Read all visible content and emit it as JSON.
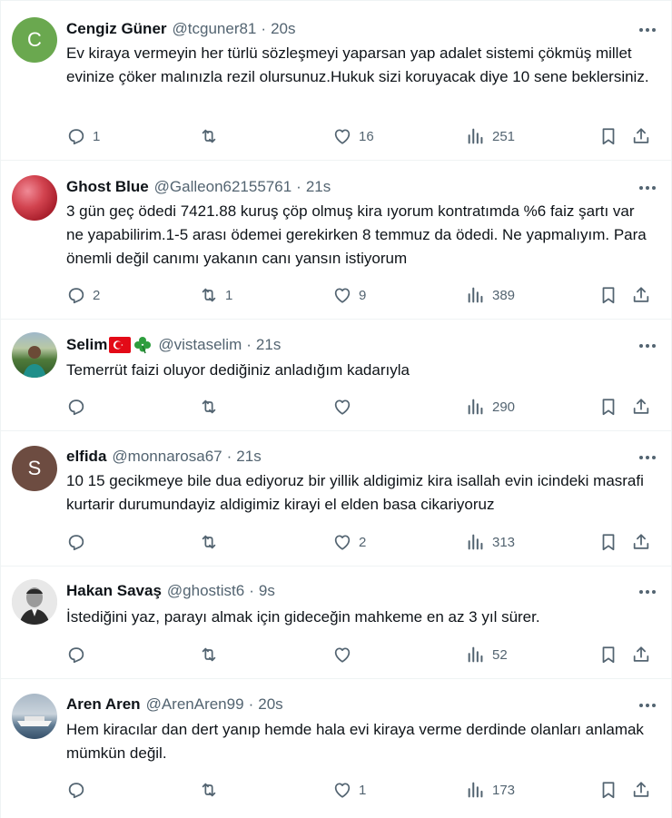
{
  "tweets": [
    {
      "name": "Cengiz Güner",
      "handle": "@tcguner81",
      "time": "20s",
      "text": "Ev kiraya vermeyin her türlü sözleşmeyi yaparsan yap adalet sistemi çökmüş millet evinize çöker malınızla rezil olursunuz.Hukuk sizi koruyacak diye 10 sene beklersiniz.",
      "replies": "1",
      "retweets": "",
      "likes": "16",
      "views": "251",
      "avatar_letter": "C",
      "avatar_color": "#6aa84f"
    },
    {
      "name": "Ghost Blue",
      "handle": "@Galleon62155761",
      "time": "21s",
      "text": "3 gün geç ödedi 7421.88 kuruş çöp olmuş kira ıyorum kontratımda %6 faiz şartı var ne yapabilirim.1-5 arası ödemei gerekirken 8  temmuz da ödedi.  Ne yapmalıyım.  Para önemli değil canımı yakanın canı yansın istiyorum",
      "replies": "2",
      "retweets": "1",
      "likes": "9",
      "views": "389",
      "avatar_letter": "",
      "avatar_color": "#c0323f"
    },
    {
      "name": "Selim",
      "handle": "@vistaselim",
      "time": "21s",
      "text": "Temerrüt faizi oluyor dediğiniz anladığım kadarıyla",
      "replies": "",
      "retweets": "",
      "likes": "",
      "views": "290",
      "avatar_letter": "",
      "avatar_color": "#4f7a3a"
    },
    {
      "name": "elfida",
      "handle": "@monnarosa67",
      "time": "21s",
      "text": "10 15 gecikmeye bile dua ediyoruz bir yillik aldigimiz kira isallah evin icindeki masrafi kurtarir durumundayiz aldigimiz kirayi el elden basa cikariyoruz",
      "replies": "",
      "retweets": "",
      "likes": "2",
      "views": "313",
      "avatar_letter": "S",
      "avatar_color": "#6d4c41"
    },
    {
      "name": "Hakan Savaş",
      "handle": "@ghostist6",
      "time": "9s",
      "text": "İstediğini yaz, parayı almak için gideceğin mahkeme en az 3 yıl sürer.",
      "replies": "",
      "retweets": "",
      "likes": "",
      "views": "52",
      "avatar_letter": "",
      "avatar_color": "#3a3a3a"
    },
    {
      "name": "Aren Aren",
      "handle": "@ArenAren99",
      "time": "20s",
      "text": "Hem kiracılar dan dert yanıp hemde hala evi kiraya verme derdinde olanları anlamak mümkün değil.",
      "replies": "",
      "retweets": "",
      "likes": "1",
      "views": "173",
      "avatar_letter": "",
      "avatar_color": "#7b93a8"
    }
  ]
}
